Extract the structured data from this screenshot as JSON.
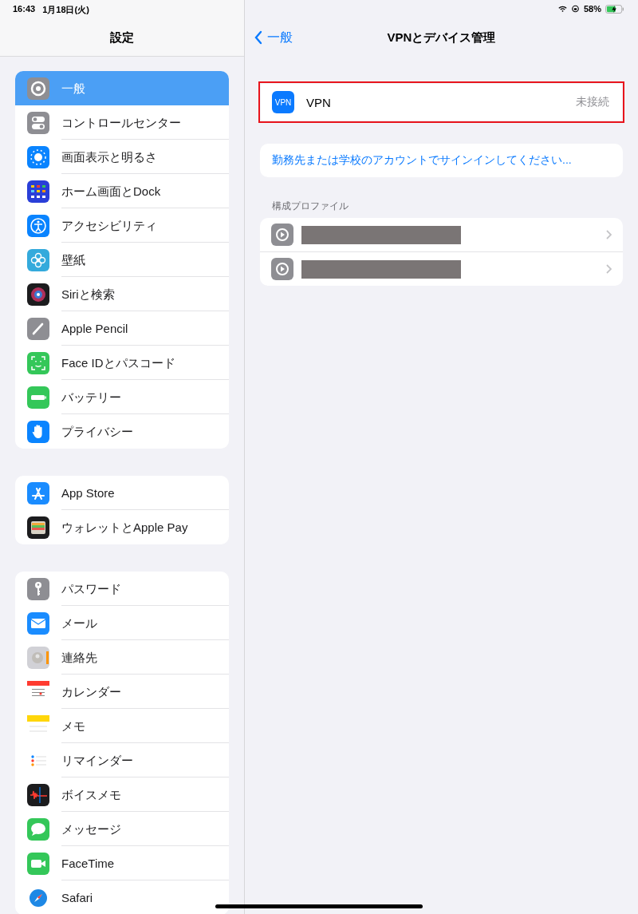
{
  "status_bar": {
    "time": "16:43",
    "date": "1月18日(火)",
    "battery": "58%"
  },
  "sidebar": {
    "title": "設定",
    "groups": [
      {
        "items": [
          {
            "label": "一般",
            "selected": true
          },
          {
            "label": "コントロールセンター",
            "selected": false
          },
          {
            "label": "画面表示と明るさ",
            "selected": false
          },
          {
            "label": "ホーム画面とDock",
            "selected": false
          },
          {
            "label": "アクセシビリティ",
            "selected": false
          },
          {
            "label": "壁紙",
            "selected": false
          },
          {
            "label": "Siriと検索",
            "selected": false
          },
          {
            "label": "Apple Pencil",
            "selected": false
          },
          {
            "label": "Face IDとパスコード",
            "selected": false
          },
          {
            "label": "バッテリー",
            "selected": false
          },
          {
            "label": "プライバシー",
            "selected": false
          }
        ]
      },
      {
        "items": [
          {
            "label": "App Store",
            "selected": false
          },
          {
            "label": "ウォレットとApple Pay",
            "selected": false
          }
        ]
      },
      {
        "items": [
          {
            "label": "パスワード",
            "selected": false
          },
          {
            "label": "メール",
            "selected": false
          },
          {
            "label": "連絡先",
            "selected": false
          },
          {
            "label": "カレンダー",
            "selected": false
          },
          {
            "label": "メモ",
            "selected": false
          },
          {
            "label": "リマインダー",
            "selected": false
          },
          {
            "label": "ボイスメモ",
            "selected": false
          },
          {
            "label": "メッセージ",
            "selected": false
          },
          {
            "label": "FaceTime",
            "selected": false
          },
          {
            "label": "Safari",
            "selected": false
          }
        ]
      }
    ]
  },
  "detail": {
    "back": "一般",
    "title": "VPNとデバイス管理",
    "vpn_row": {
      "icon_text": "VPN",
      "label": "VPN",
      "status": "未接続",
      "highlighted": true
    },
    "sign_in": "勤務先または学校のアカウントでサインインしてください...",
    "profiles_header": "構成プロファイル",
    "profiles": [
      {
        "kind": "redacted"
      },
      {
        "kind": "redacted"
      }
    ]
  }
}
